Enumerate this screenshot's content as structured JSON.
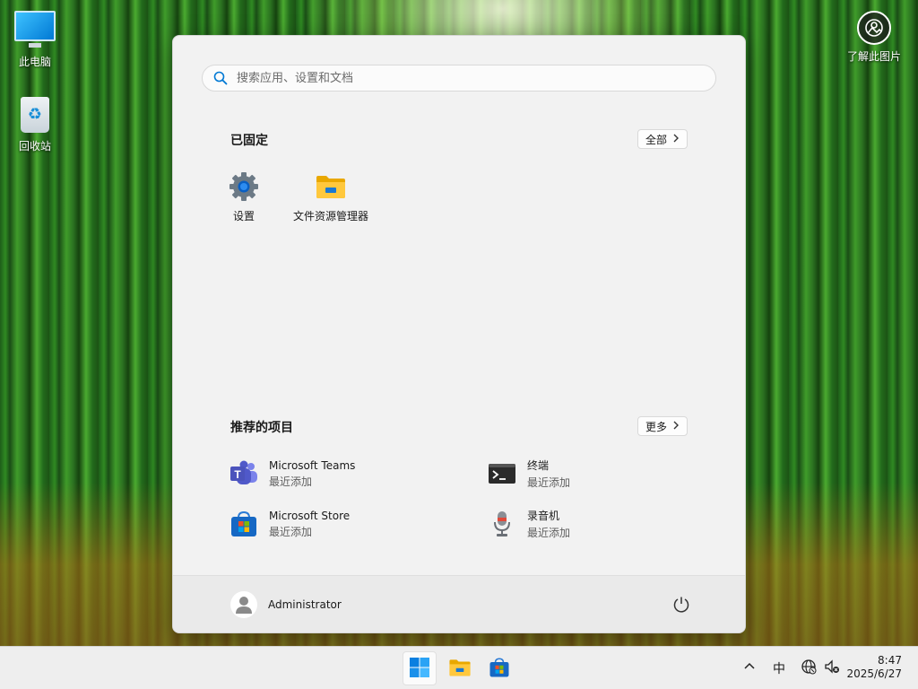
{
  "desktop": {
    "icons": [
      {
        "label": "此电脑"
      },
      {
        "label": "回收站"
      }
    ],
    "learn_label": "了解此图片"
  },
  "start_menu": {
    "search_placeholder": "搜索应用、设置和文档",
    "pinned": {
      "title": "已固定",
      "all_button": "全部",
      "apps": [
        {
          "label": "设置",
          "icon": "gear-icon"
        },
        {
          "label": "文件资源管理器",
          "icon": "folder-icon"
        }
      ]
    },
    "recommended": {
      "title": "推荐的项目",
      "more_button": "更多",
      "items": [
        {
          "name": "Microsoft Teams",
          "sub": "最近添加",
          "icon": "teams-icon"
        },
        {
          "name": "终端",
          "sub": "最近添加",
          "icon": "terminal-icon"
        },
        {
          "name": "Microsoft Store",
          "sub": "最近添加",
          "icon": "store-icon"
        },
        {
          "name": "录音机",
          "sub": "最近添加",
          "icon": "microphone-icon"
        }
      ]
    },
    "user": {
      "name": "Administrator"
    }
  },
  "taskbar": {
    "ime": "中",
    "time": "8:47",
    "date": "2025/6/27"
  },
  "colors": {
    "accent": "#0078d4",
    "start_bg": "#f2f2f2",
    "taskbar_bg": "#eeeeee"
  }
}
